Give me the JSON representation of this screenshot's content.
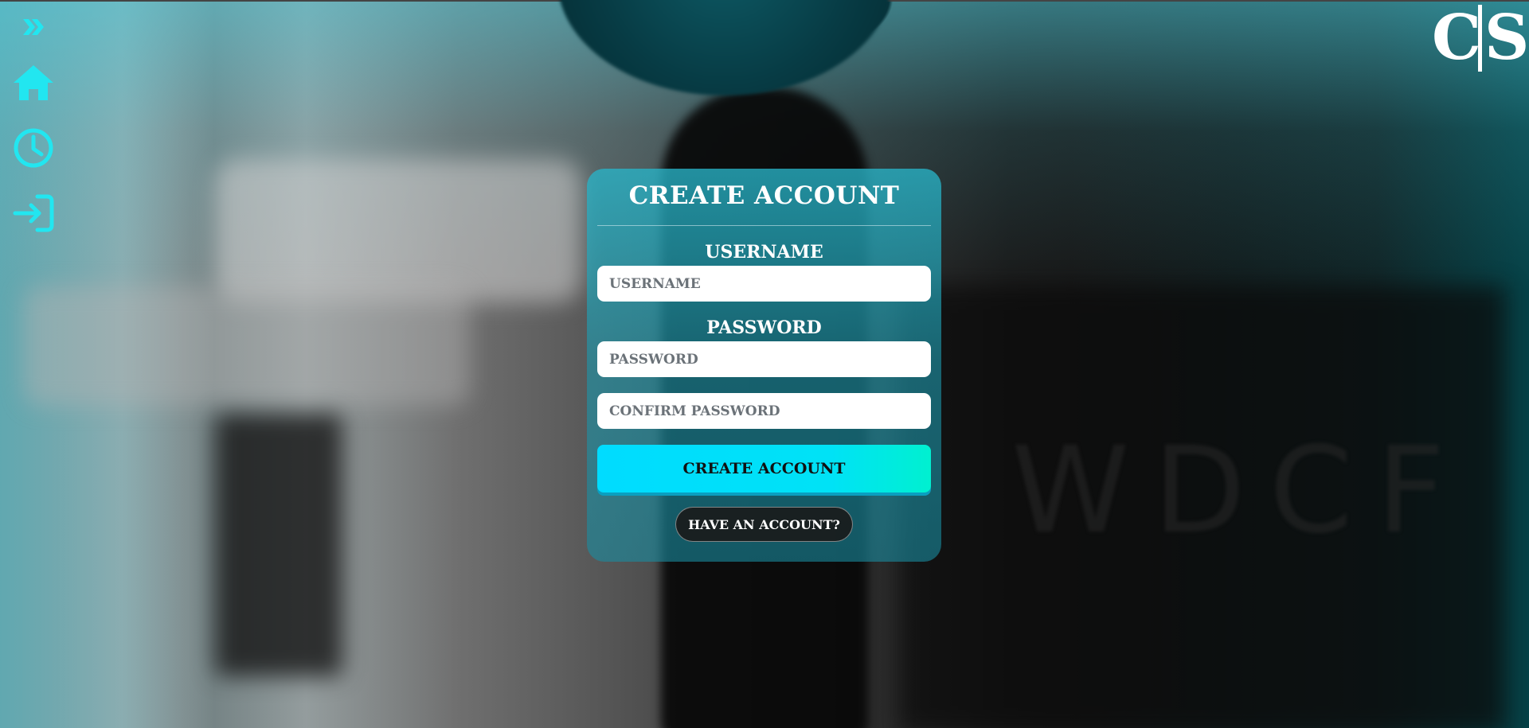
{
  "sidebar": {
    "items": [
      {
        "icon": "chevron-double-right-icon"
      },
      {
        "icon": "home-icon"
      },
      {
        "icon": "clock-icon"
      },
      {
        "icon": "login-icon"
      }
    ],
    "accent_color": "#22e6f0"
  },
  "logo": {
    "text": "C|S"
  },
  "form": {
    "title": "CREATE ACCOUNT",
    "username_label": "USERNAME",
    "username_placeholder": "USERNAME",
    "username_value": "",
    "password_label": "PASSWORD",
    "password_placeholder": "PASSWORD",
    "password_value": "",
    "confirm_placeholder": "CONFIRM PASSWORD",
    "confirm_value": "",
    "submit_label": "CREATE ACCOUNT",
    "have_account_label": "HAVE AN ACCOUNT?"
  },
  "background": {
    "text": "WDCF"
  },
  "colors": {
    "button_start": "#00dcff",
    "button_end": "#00f0d0",
    "card": "#28b4c8"
  }
}
